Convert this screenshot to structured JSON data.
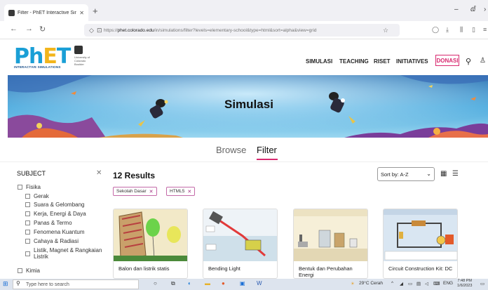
{
  "browser": {
    "tab_title": "Filter - PhET Interactive Simulati",
    "url_host": "phet.colorado.edu",
    "url_prefix": "https://",
    "url_path": "/in/simulations/filter?levels=elementary-school&type=html&sort=alpha&view=grid"
  },
  "header": {
    "logo_word": "PhET",
    "logo_sub": "INTERACTIVE SIMULATIONS",
    "university": "University of Colorado Boulder",
    "menu": [
      "SIMULASI",
      "TEACHING",
      "RISET",
      "INITIATIVES"
    ],
    "donate": "DONASI"
  },
  "banner": {
    "title": "Simulasi"
  },
  "tabs": {
    "browse": "Browse",
    "filter": "Filter"
  },
  "sidebar": {
    "heading": "SUBJECT",
    "groups": [
      {
        "label": "Fisika",
        "items": [
          "Gerak",
          "Suara & Gelombang",
          "Kerja, Energi & Daya",
          "Panas & Termo",
          "Fenomena Kuantum",
          "Cahaya & Radiasi",
          "Listik, Magnet & Rangkaian Listrik"
        ]
      },
      {
        "label": "Kimia",
        "items": []
      }
    ]
  },
  "results": {
    "count_label": "12 Results",
    "chips": [
      "Sekolah Dasar",
      "HTML5"
    ],
    "sort": "Sort by:  A-Z"
  },
  "cards": [
    {
      "title": "Balon dan listrik statis"
    },
    {
      "title": "Bending Light"
    },
    {
      "title": "Bentuk dan Perubahan Energi"
    },
    {
      "title": "Circuit Construction Kit: DC"
    }
  ],
  "taskbar": {
    "search_placeholder": "Type here to search",
    "weather": "29°C  Cerah",
    "lang": "ENG",
    "time": "7:48 PM",
    "date": "1/6/2023"
  }
}
